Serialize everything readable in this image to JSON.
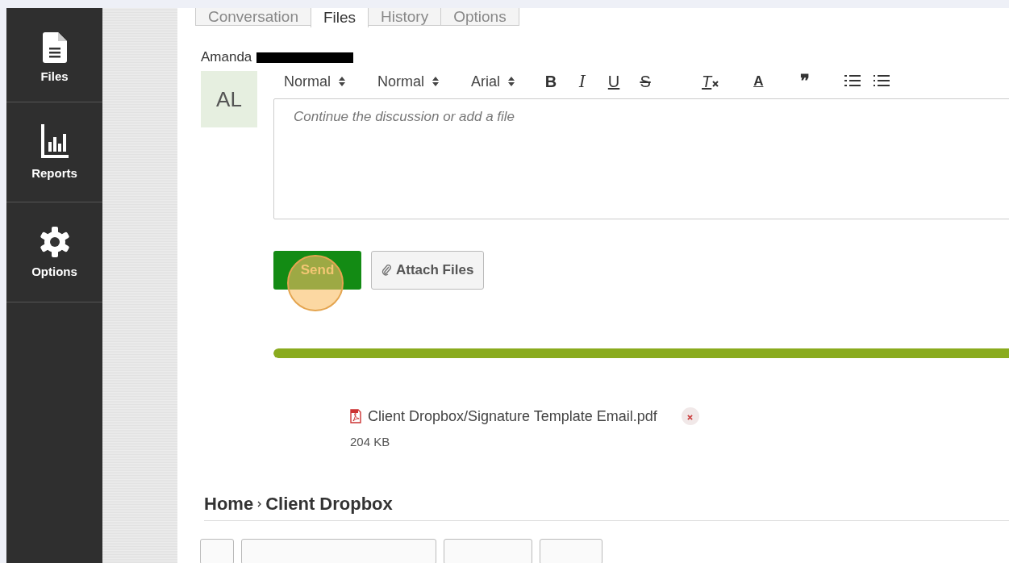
{
  "sidebar": {
    "items": [
      {
        "label": "Files"
      },
      {
        "label": "Reports"
      },
      {
        "label": "Options"
      }
    ]
  },
  "tabs": [
    {
      "label": "Conversation",
      "selected": false
    },
    {
      "label": "Files",
      "selected": true
    },
    {
      "label": "History",
      "selected": false
    },
    {
      "label": "Options",
      "selected": false
    }
  ],
  "author": {
    "name": "Amanda",
    "redacted": true,
    "initials": "AL"
  },
  "toolbar": {
    "selects": [
      "Normal",
      "Normal",
      "Arial"
    ],
    "buttons": [
      {
        "kind": "bold",
        "glyph": "B"
      },
      {
        "kind": "italic",
        "glyph": "I"
      },
      {
        "kind": "underline",
        "glyph": "U"
      },
      {
        "kind": "strike",
        "glyph": "S"
      },
      {
        "kind": "clear",
        "glyph": "T"
      },
      {
        "kind": "color",
        "glyph": "A"
      },
      {
        "kind": "quote",
        "glyph": "❞"
      },
      {
        "kind": "ordered"
      },
      {
        "kind": "bullet"
      }
    ]
  },
  "editor": {
    "placeholder": "Continue the discussion or add a file"
  },
  "actions": {
    "send": "Send",
    "attach": "Attach Files"
  },
  "upload": {
    "level": 1,
    "file": {
      "name": "Client Dropbox/Signature Template Email.pdf",
      "size": "204 KB"
    }
  },
  "breadcrumb": [
    "Home",
    "Client Dropbox"
  ]
}
